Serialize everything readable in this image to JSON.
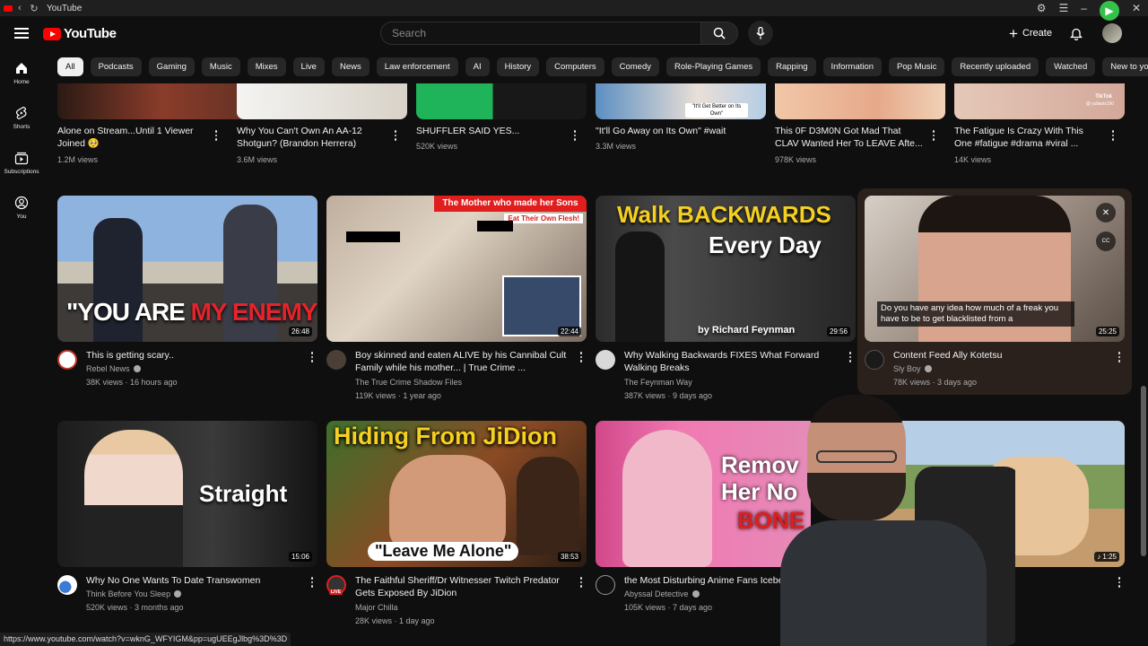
{
  "browser": {
    "tab_title": "YouTube",
    "status_url": "https://www.youtube.com/watch?v=wknG_WFYIGM&pp=ugUEEgJlbg%3D%3D"
  },
  "header": {
    "logo_text": "YouTube",
    "search_placeholder": "Search",
    "create_label": "Create"
  },
  "sidebar": {
    "items": [
      {
        "label": "Home",
        "icon": "home-icon"
      },
      {
        "label": "Shorts",
        "icon": "shorts-icon"
      },
      {
        "label": "Subscriptions",
        "icon": "subscriptions-icon"
      },
      {
        "label": "You",
        "icon": "you-icon"
      }
    ]
  },
  "chips": [
    "All",
    "Podcasts",
    "Gaming",
    "Music",
    "Mixes",
    "Live",
    "News",
    "Law enforcement",
    "AI",
    "History",
    "Computers",
    "Comedy",
    "Role-Playing Games",
    "Rapping",
    "Information",
    "Pop Music",
    "Recently uploaded",
    "Watched",
    "New to you"
  ],
  "row1": [
    {
      "title_l1": "Alone on Stream...Until 1 Viewer",
      "title_l2": "Joined 🥺",
      "views": "1.2M views"
    },
    {
      "title_l1": "Why You Can't Own An AA-12",
      "title_l2": "Shotgun? (Brandon Herrera)",
      "views": "3.6M views"
    },
    {
      "title_l1": "SHUFFLER SAID YES...",
      "title_l2": "",
      "views": "520K views"
    },
    {
      "title_l1": "\"It'll Go Away on Its Own\" #wait",
      "title_l2": "",
      "views": "3.3M views",
      "thumb_caption": "\"It'll Get Better on Its Own\""
    },
    {
      "title_l1": "This 0F D3M0N Got Mad That",
      "title_l2": "CLAV Wanted Her To LEAVE Afte...",
      "views": "978K views"
    },
    {
      "title_l1": "The Fatigue Is Crazy With This",
      "title_l2": "One #fatigue #drama #viral ...",
      "views": "14K views",
      "thumb_badge": "TikTok",
      "thumb_handle": "@ yuliaxix190"
    }
  ],
  "row2": [
    {
      "title_l1": "This is getting scary..",
      "title_l2": "",
      "channel": "Rebel News",
      "meta": "38K views · 16 hours ago",
      "duration": "26:48",
      "thumb_text_a": "\"YOU ARE ",
      "thumb_text_b": "MY ENEMY\""
    },
    {
      "title_l1": "Boy skinned and eaten ALIVE by his Cannibal Cult",
      "title_l2": "Family while his mother... | True Crime ...",
      "channel": "The True Crime Shadow Files",
      "meta": "119K views · 1 year ago",
      "duration": "22:44",
      "thumb_banner": "The Mother who made her Sons",
      "thumb_banner2": "Eat Their Own Flesh!"
    },
    {
      "title_l1": "Why Walking Backwards FIXES What Forward",
      "title_l2": "Walking Breaks",
      "channel": "The Feynman Way",
      "meta": "387K views · 9 days ago",
      "duration": "29:56",
      "thumb_text_a": "Walk BACKWARDS",
      "thumb_text_b": "Every Day",
      "thumb_text_c": "by Richard Feynman"
    },
    {
      "title_l1": "Content Feed Ally Kotetsu",
      "title_l2": "",
      "channel": "Sly Boy",
      "meta": "78K views · 3 days ago",
      "duration": "25:25",
      "caption": "Do you have any idea how much of a freak you have to be to get blacklisted from a"
    }
  ],
  "row3": [
    {
      "title_l1": "Why No One Wants To Date Transwomen",
      "title_l2": "",
      "channel": "Think Before You Sleep",
      "meta": "520K views · 3 months ago",
      "duration": "15:06",
      "thumb_text_a": "Straight"
    },
    {
      "title_l1": "The Faithful Sheriff/Dr Witnesser Twitch Predator",
      "title_l2": "Gets Exposed By JiDion",
      "channel": "Major Chilla",
      "meta": "28K views · 1 day ago",
      "duration": "38:53",
      "thumb_text_a": "Hiding From JiDion",
      "thumb_text_b": "\"Leave Me Alone\"",
      "live_badge": "LIVE"
    },
    {
      "title_l1": "the Most Disturbing Anime Fans Icebe",
      "title_l2": "",
      "channel": "Abyssal Detective",
      "meta": "105K views · 7 days ago",
      "thumb_text_a": "Remov",
      "thumb_text_b": "Her No",
      "thumb_text_c": "BONE"
    },
    {
      "title_l1": "",
      "title_l2": "",
      "duration": "1:25",
      "meta_tail": "o"
    }
  ],
  "colors": {
    "background": "#0f0f0f",
    "chip": "#272727",
    "brand": "#ff0000",
    "active_chip": "#f1f1f1"
  }
}
